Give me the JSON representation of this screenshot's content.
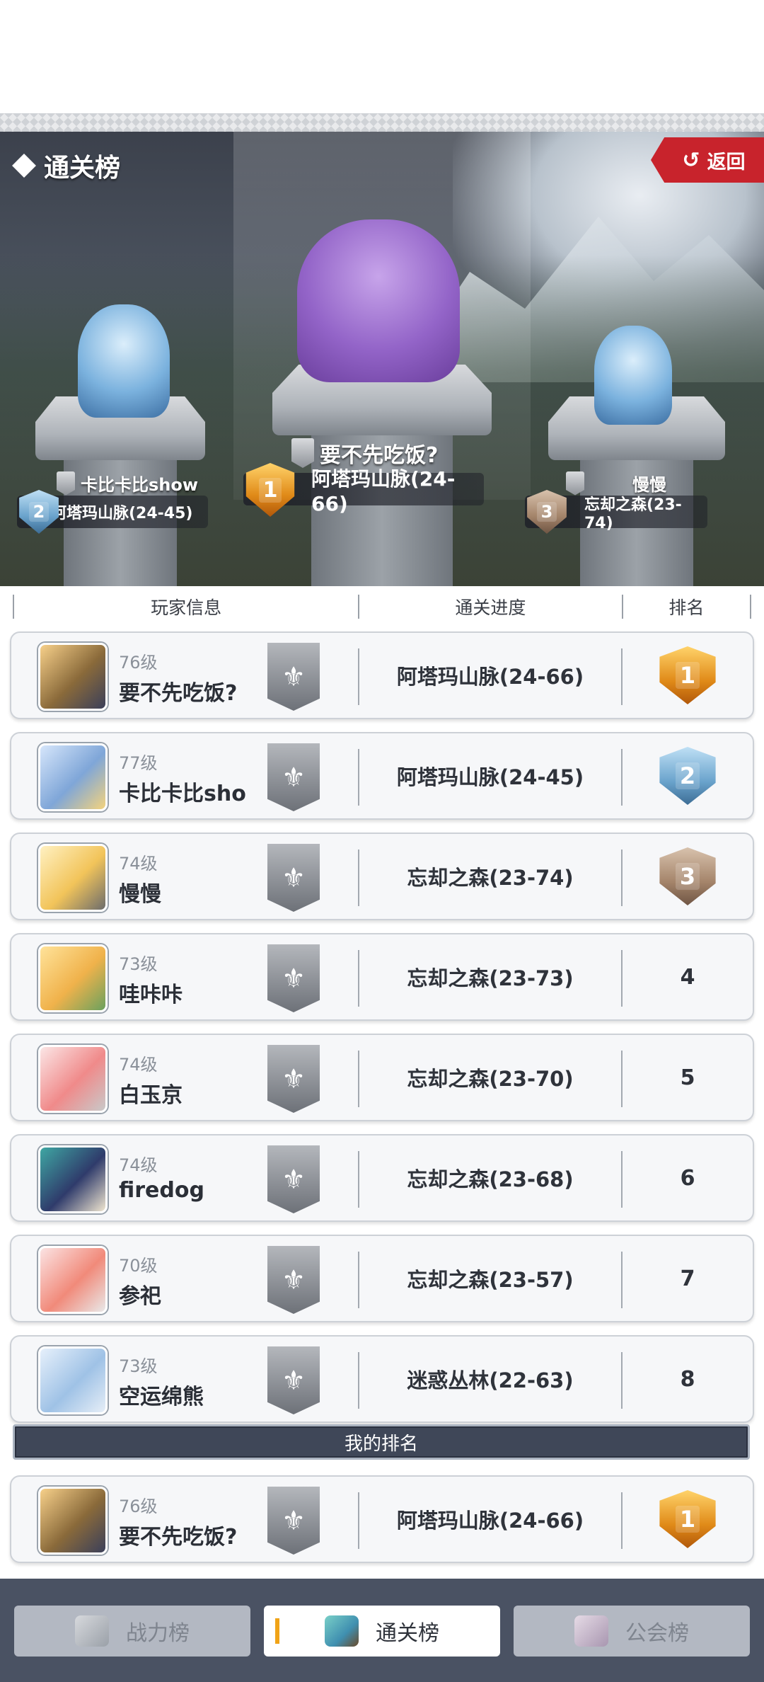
{
  "header": {
    "title": "通关榜",
    "back_label": "返回"
  },
  "podium": {
    "first": {
      "name": "要不先吃饭?",
      "progress": "阿塔玛山脉(24-66)",
      "rank": "1"
    },
    "second": {
      "name": "卡比卡比show",
      "progress": "阿塔玛山脉(24-45)",
      "rank": "2"
    },
    "third": {
      "name": "慢慢",
      "progress": "忘却之森(23-74)",
      "rank": "3"
    }
  },
  "table": {
    "headers": {
      "info": "玩家信息",
      "progress": "通关进度",
      "rank": "排名"
    },
    "rows": [
      {
        "level": "76级",
        "name": "要不先吃饭?",
        "progress": "阿塔玛山脉(24-66)",
        "rank": "1",
        "rank_style": "gold"
      },
      {
        "level": "77级",
        "name": "卡比卡比sho",
        "progress": "阿塔玛山脉(24-45)",
        "rank": "2",
        "rank_style": "silver"
      },
      {
        "level": "74级",
        "name": "慢慢",
        "progress": "忘却之森(23-74)",
        "rank": "3",
        "rank_style": "bronze"
      },
      {
        "level": "73级",
        "name": "哇咔咔",
        "progress": "忘却之森(23-73)",
        "rank": "4"
      },
      {
        "level": "74级",
        "name": "白玉京",
        "progress": "忘却之森(23-70)",
        "rank": "5"
      },
      {
        "level": "74级",
        "name": "firedog",
        "progress": "忘却之森(23-68)",
        "rank": "6"
      },
      {
        "level": "70级",
        "name": "参祀",
        "progress": "忘却之森(23-57)",
        "rank": "7"
      },
      {
        "level": "73级",
        "name": "空运绵熊",
        "progress": "迷惑丛林(22-63)",
        "rank": "8"
      }
    ]
  },
  "my_rank": {
    "label": "我的排名",
    "level": "76级",
    "name": "要不先吃饭?",
    "progress": "阿塔玛山脉(24-66)",
    "rank": "1"
  },
  "tabs": [
    {
      "label": "战力榜",
      "state": "inactive"
    },
    {
      "label": "通关榜",
      "state": "active"
    },
    {
      "label": "公会榜",
      "state": "inactive"
    }
  ],
  "colors": {
    "accent_red": "#c8232c",
    "gold": "#e08a18",
    "silver": "#6aa3cc",
    "bronze": "#a4846a",
    "tabbar": "#4a5263"
  }
}
